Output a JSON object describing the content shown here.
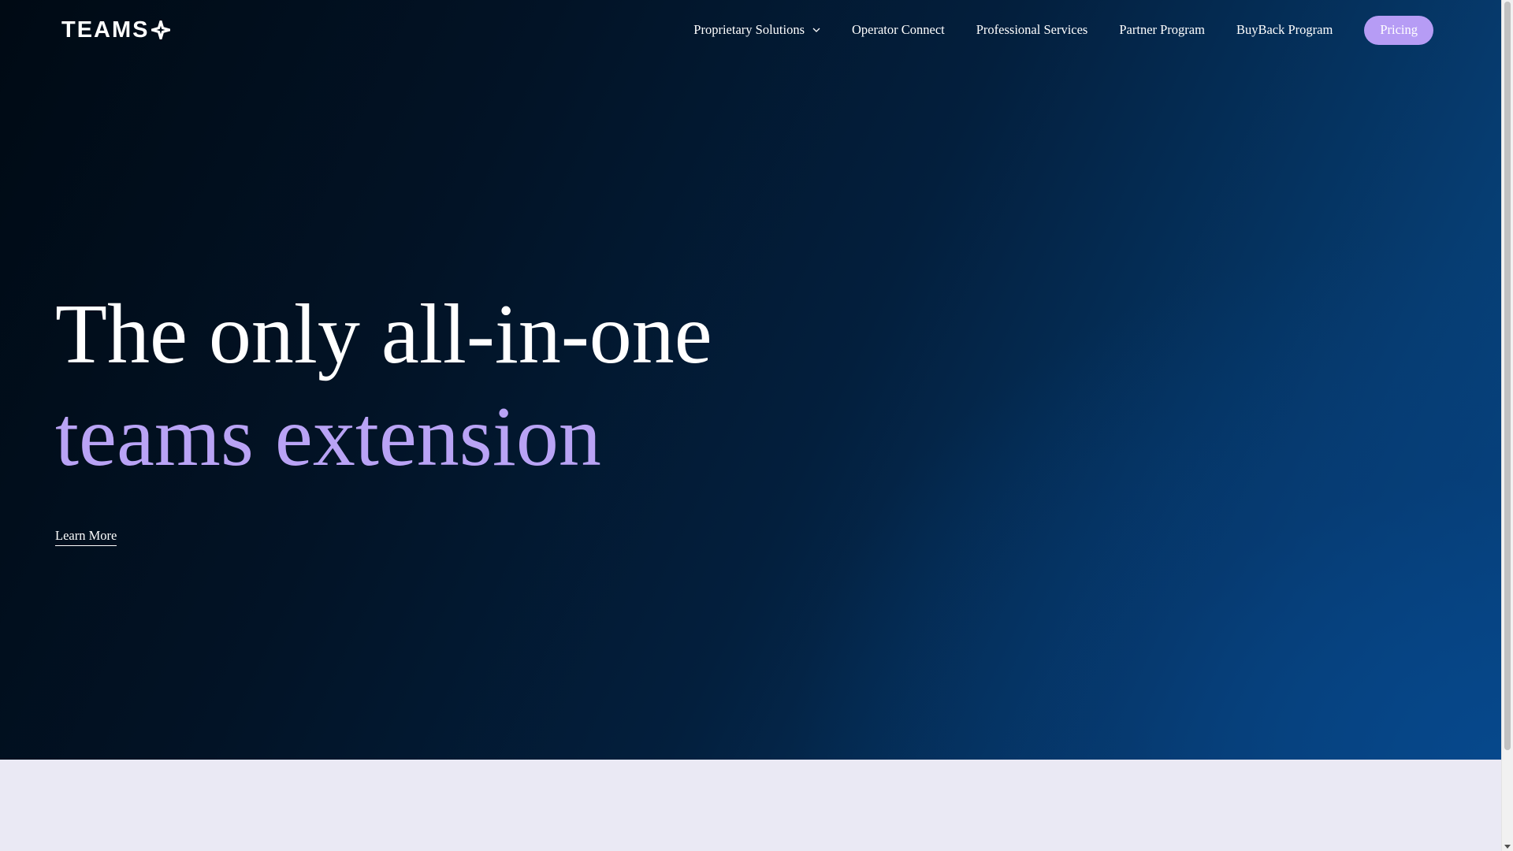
{
  "header": {
    "logo_text": "TEAMS",
    "logo_icon": "plus-cross-icon",
    "nav": {
      "items": [
        {
          "label": "Proprietary Solutions",
          "has_dropdown": true
        },
        {
          "label": "Operator Connect"
        },
        {
          "label": "Professional Services"
        },
        {
          "label": "Partner Program"
        },
        {
          "label": "BuyBack Program"
        }
      ],
      "pricing_label": "Pricing"
    }
  },
  "hero": {
    "headline_line_1": "The only all-in-one",
    "headline_line_2": "teams extension",
    "cta_label": "Learn More"
  },
  "colors": {
    "accent_purple": "#b69cf5",
    "headline_accent": "#b9a3f5",
    "hero_dark": "#000a14",
    "hero_blue": "#074886",
    "lower_section_bg": "#eae9f4"
  }
}
